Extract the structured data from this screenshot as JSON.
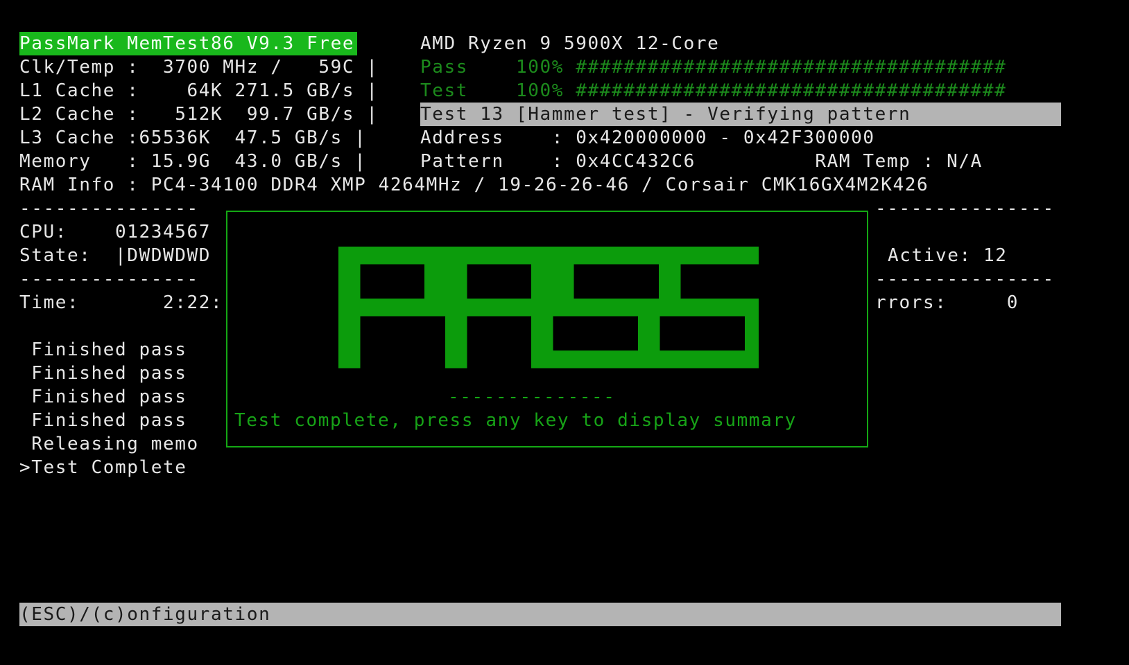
{
  "header": {
    "app_title": "PassMark MemTest86 V9.3 Free",
    "cpu_model": "AMD Ryzen 9 5900X 12-Core"
  },
  "system_info": [
    "Clk/Temp :  3700 MHz /   59C |",
    "L1 Cache :    64K 271.5 GB/s |",
    "L2 Cache :   512K  99.7 GB/s |",
    "L3 Cache :65536K  47.5 GB/s |",
    "Memory   : 15.9G  43.0 GB/s |",
    "RAM Info : PC4-34100 DDR4 XMP 4264MHz / 19-26-26-46 / Corsair CMK16GX4M2K426"
  ],
  "progress": {
    "pass_label": "Pass",
    "pass_percent": "100%",
    "pass_value": 1.0,
    "test_label": "Test",
    "test_percent": "100%",
    "test_value": 1.0,
    "hash_bar": "####################################"
  },
  "current_test": "Test 13 [Hammer test] - Verifying pattern",
  "address_line": "Address    : 0x420000000 - 0x42F300000",
  "pattern_line": "Pattern    : 0x4CC432C6          RAM Temp : N/A",
  "dashes": {
    "left": "---------------",
    "right": "---------------"
  },
  "left_panel": {
    "cpu": "CPU:    01234567",
    "state": "State:  |DWDWDWD",
    "time": "Time:       2:22:"
  },
  "right_panel": {
    "active": "Active: 12",
    "errors": "rrors:     0"
  },
  "log": [
    " Finished pass",
    " Finished pass",
    " Finished pass",
    " Finished pass",
    " Releasing memo",
    ">Test Complete"
  ],
  "result_box": {
    "result_text": "PASS",
    "separator": "--------------",
    "message": "Test complete, press any key to display summary",
    "color": "#0c9c0c"
  },
  "footer": {
    "hint": "(ESC)/(c)onfiguration"
  }
}
